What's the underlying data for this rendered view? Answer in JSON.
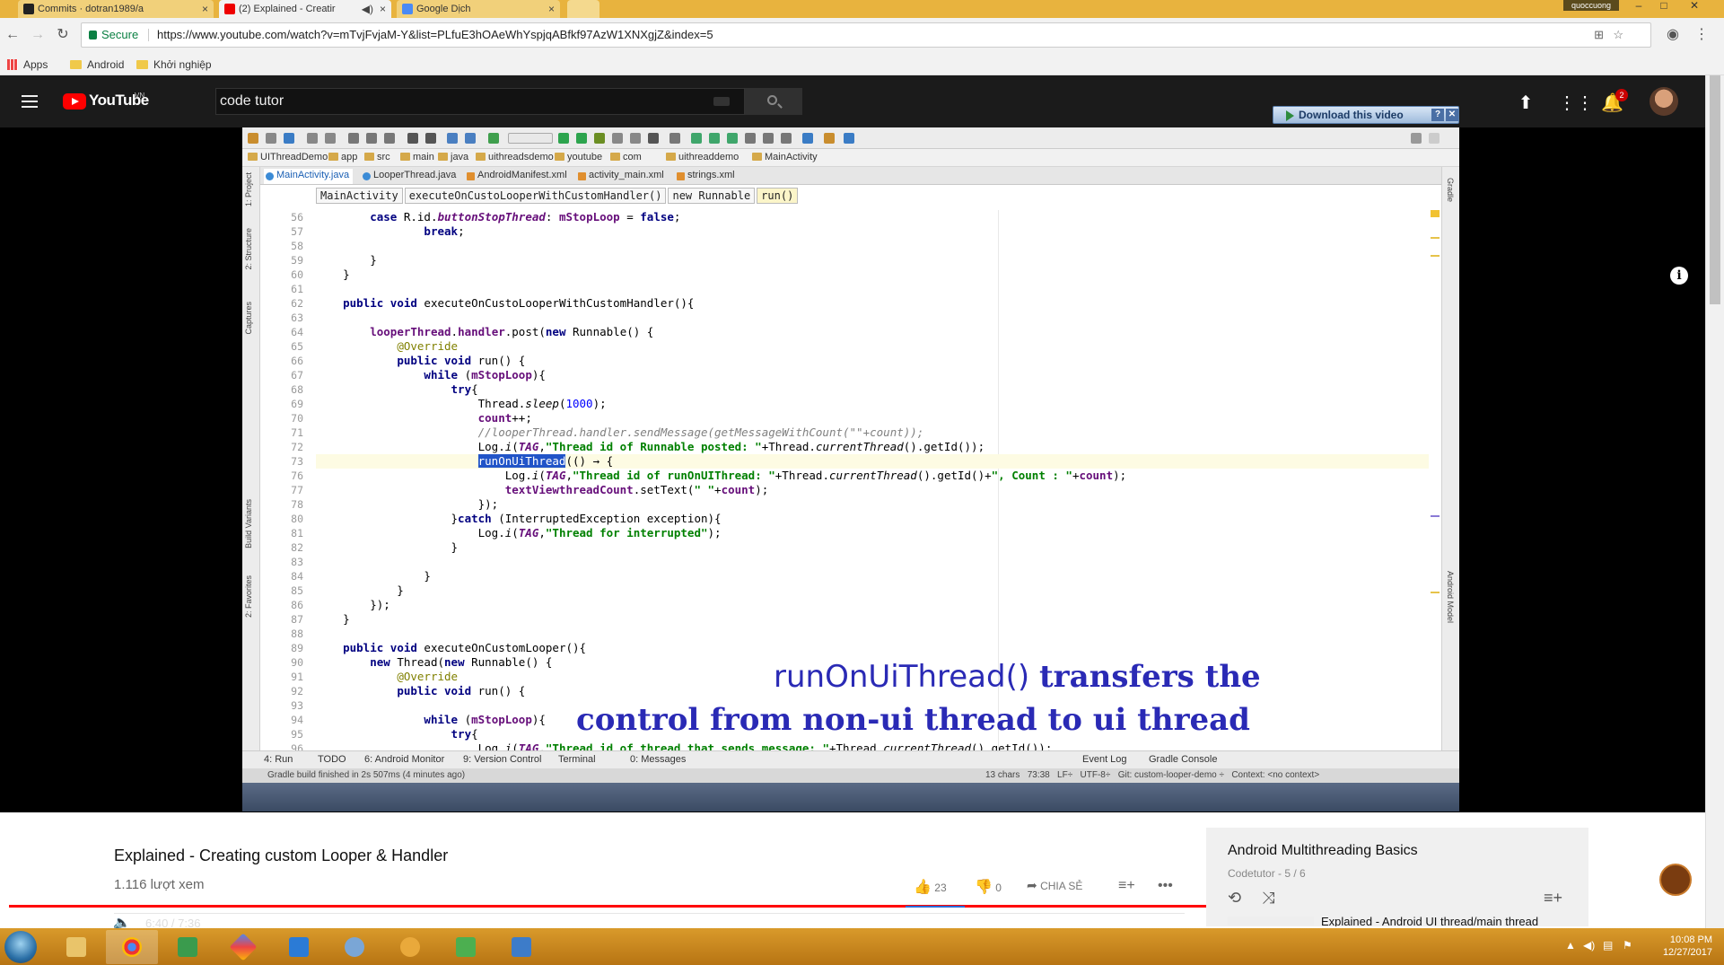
{
  "browser": {
    "tabs": [
      {
        "title": "Commits · dotran1989/a",
        "close": "×"
      },
      {
        "title": "(2) Explained - Creatir",
        "close": "×"
      },
      {
        "title": "Google Dịch",
        "close": "×"
      }
    ],
    "profile": "quoccuong",
    "window_controls": {
      "minimize": "–",
      "maximize": "□",
      "close": "✕"
    },
    "secure_label": "Secure",
    "url": "https://www.youtube.com/watch?v=mTvjFvjaM-Y&list=PLfuE3hOAeWhYspjqABfkf97AzW1XNXgjZ&index=5",
    "bookmarks": [
      "Apps",
      "Android",
      "Khởi nghiệp"
    ]
  },
  "youtube": {
    "logo": "YouTube",
    "country": "VN",
    "search_value": "code tutor",
    "notification_count": "2"
  },
  "ide": {
    "project_crumbs": [
      "UIThreadDemo",
      "app",
      "src",
      "main",
      "java",
      "uithreadsdemo",
      "youtube",
      "com",
      "uithreaddemo",
      "MainActivity"
    ],
    "file_tabs": [
      "MainActivity.java",
      "LooperThread.java",
      "AndroidManifest.xml",
      "activity_main.xml",
      "strings.xml"
    ],
    "code_breadcrumbs": [
      "MainActivity",
      "executeOnCustoLooperWithCustomHandler()",
      "new Runnable",
      "run()"
    ],
    "left_tool_windows": [
      "1: Project",
      "2: Structure",
      "Captures",
      "Build Variants",
      "2: Favorites"
    ],
    "right_tool_windows": [
      "Gradle",
      "Android Model"
    ],
    "line_numbers": [
      "56",
      "57",
      "58",
      "59",
      "60",
      "61",
      "62",
      "63",
      "64",
      "65",
      "66",
      "67",
      "68",
      "69",
      "70",
      "71",
      "72",
      "73",
      "76",
      "77",
      "78",
      "80",
      "81",
      "82",
      "83",
      "84",
      "85",
      "86",
      "87",
      "88",
      "89",
      "90",
      "91",
      "92",
      "93",
      "94",
      "95",
      "96"
    ],
    "bottom_tabs": [
      "4: Run",
      "TODO",
      "6: Android Monitor",
      "9: Version Control",
      "Terminal",
      "0: Messages",
      "Event Log",
      "Gradle Console"
    ],
    "status_left": "Gradle build finished in 2s 507ms (4 minutes ago)",
    "status_right": "13 chars   73:38   LF÷   UTF-8÷   Git: custom-looper-demo ÷   Context: <no context>"
  },
  "overlay": {
    "line1_plain": "runOnUiThread()",
    "line1_bold": "transfers the",
    "line2": "control from non-ui thread to ui thread"
  },
  "download_button": "Download this video",
  "player": {
    "time": "6:40 / 7:36",
    "progress_played": 0.877,
    "progress_loaded": 0.895
  },
  "video": {
    "title": "Explained - Creating custom Looper & Handler",
    "views": "1.116 lượt xem",
    "likes": "23",
    "dislikes": "0",
    "share_label": "CHIA SẺ"
  },
  "playlist": {
    "title": "Android Multithreading Basics",
    "subtitle": "Codetutor - 5 / 6",
    "next_item_title": "Explained - Android UI thread/main thread"
  },
  "taskbar": {
    "time": "10:08 PM",
    "date": "12/27/2017"
  }
}
